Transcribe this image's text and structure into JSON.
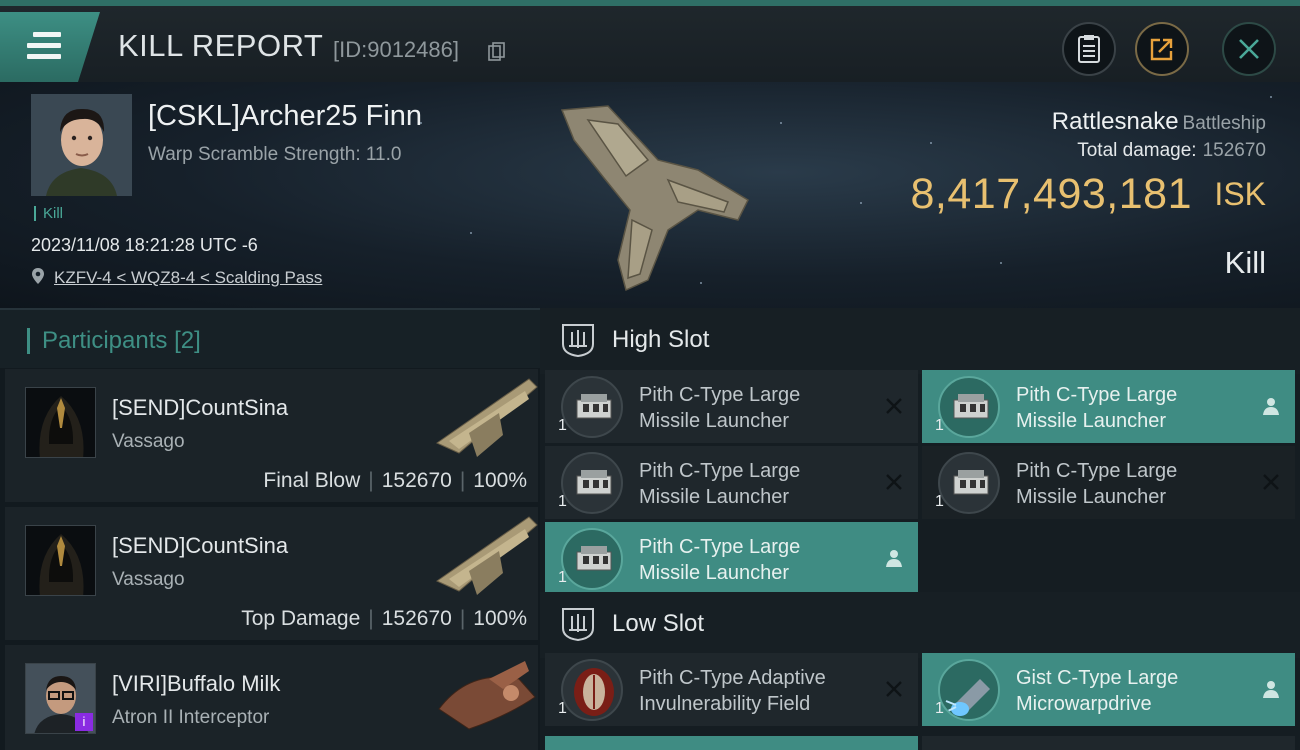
{
  "header": {
    "title": "KILL REPORT",
    "report_id": "[ID:9012486]",
    "icons": [
      "menu-icon",
      "copy-icon",
      "clipboard-icon",
      "share-icon",
      "close-icon"
    ]
  },
  "victim": {
    "name": "[CSKL]Archer25 Finn",
    "warp_scramble": "Warp Scramble Strength: 11.0",
    "tag": "Kill",
    "datetime": "2023/11/08 18:21:28 UTC -6",
    "location": "KZFV-4 < WQZ8-4 < Scalding Pass",
    "ship_name": "Rattlesnake",
    "ship_class": "Battleship",
    "total_damage_label": "Total damage:",
    "total_damage": "152670",
    "isk_value": "8,417,493,181",
    "isk_unit": "ISK",
    "result": "Kill"
  },
  "participants": {
    "title": "Participants",
    "count": "[2]",
    "items": [
      {
        "name": "[SEND]CountSina",
        "ship": "Vassago",
        "role": "Final Blow",
        "damage": "152670",
        "percent": "100%"
      },
      {
        "name": "[SEND]CountSina",
        "ship": "Vassago",
        "role": "Top Damage",
        "damage": "152670",
        "percent": "100%"
      },
      {
        "name": "[VIRI]Buffalo Milk",
        "ship": "Atron II Interceptor",
        "badge": "i"
      }
    ]
  },
  "slots": {
    "high": {
      "label": "High Slot",
      "modules": [
        {
          "name1": "Pith C-Type Large",
          "name2": "Missile Launcher",
          "qty": "1",
          "state": "destroyed"
        },
        {
          "name1": "Pith C-Type Large",
          "name2": "Missile Launcher",
          "qty": "1",
          "state": "dropped"
        },
        {
          "name1": "Pith C-Type Large",
          "name2": "Missile Launcher",
          "qty": "1",
          "state": "destroyed"
        },
        {
          "name1": "Pith C-Type Large",
          "name2": "Missile Launcher",
          "qty": "1",
          "state": "destroyed"
        },
        {
          "name1": "Pith C-Type Large",
          "name2": "Missile Launcher",
          "qty": "1",
          "state": "dropped"
        }
      ]
    },
    "low": {
      "label": "Low Slot",
      "modules": [
        {
          "name1": "Pith C-Type Adaptive",
          "name2": "Invulnerability Field",
          "qty": "1",
          "state": "destroyed"
        },
        {
          "name1": "Gist C-Type Large",
          "name2": "Microwarpdrive",
          "qty": "1",
          "state": "dropped"
        }
      ]
    }
  },
  "colors": {
    "accent": "#3f8c83",
    "isk": "#e8c070",
    "header_bg": "#1f272c"
  }
}
